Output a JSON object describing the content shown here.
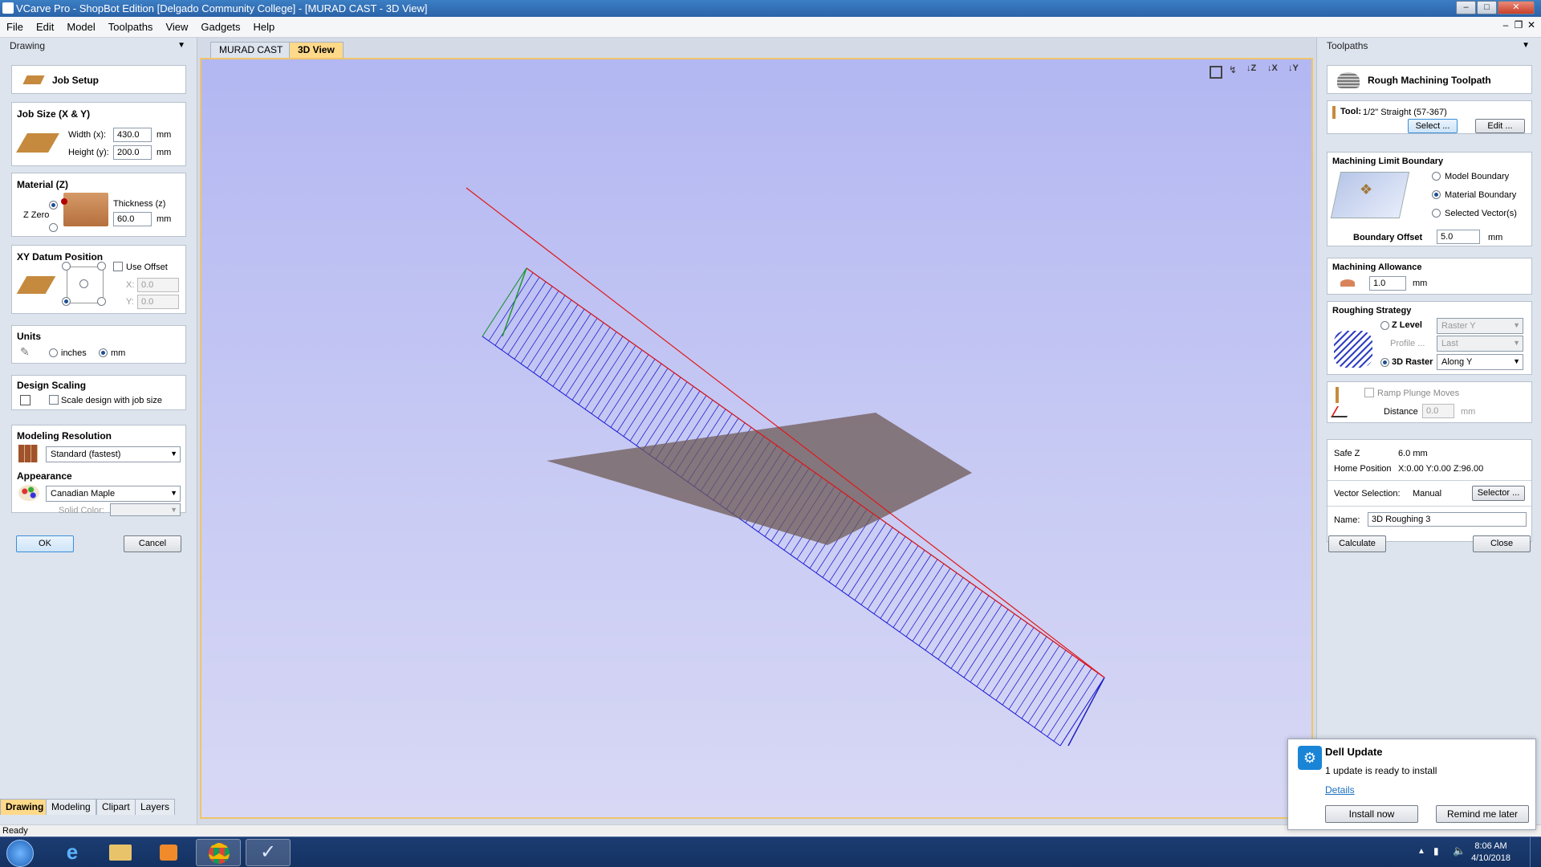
{
  "window": {
    "title": "VCarve Pro - ShopBot Edition [Delgado Community College] - [MURAD CAST - 3D View]"
  },
  "menu": [
    "File",
    "Edit",
    "Model",
    "Toolpaths",
    "View",
    "Gadgets",
    "Help"
  ],
  "left_panel": {
    "header": "Drawing",
    "job_setup": "Job Setup",
    "job_size": {
      "title": "Job Size (X & Y)",
      "width_label": "Width (x):",
      "width_value": "430.0",
      "height_label": "Height (y):",
      "height_value": "200.0",
      "unit": "mm"
    },
    "material": {
      "title": "Material (Z)",
      "z_zero": "Z Zero",
      "thickness_label": "Thickness (z)",
      "thickness_value": "60.0",
      "unit": "mm"
    },
    "xy_datum": {
      "title": "XY Datum Position",
      "use_offset": "Use Offset",
      "x_label": "X:",
      "x_value": "0.0",
      "y_label": "Y:",
      "y_value": "0.0"
    },
    "units": {
      "title": "Units",
      "inches": "inches",
      "mm": "mm"
    },
    "design_scaling": {
      "title": "Design Scaling",
      "scale_label": "Scale design with job size"
    },
    "modeling_resolution": {
      "title": "Modeling Resolution",
      "value": "Standard (fastest)"
    },
    "appearance": {
      "title": "Appearance",
      "value": "Canadian Maple",
      "solid_color": "Solid Color:"
    },
    "ok": "OK",
    "cancel": "Cancel",
    "tabs": [
      "Drawing",
      "Modeling",
      "Clipart",
      "Layers"
    ]
  },
  "doc_tabs": [
    "MURAD CAST",
    "3D View"
  ],
  "view_icons": [
    "fit-view-icon",
    "iso-view-icon",
    "z-view-icon",
    "x-view-icon",
    "y-view-icon"
  ],
  "right_panel": {
    "header": "Toolpaths",
    "title": "Rough Machining Toolpath",
    "tool": {
      "label": "Tool:",
      "value": "1/2\" Straight  (57-367)",
      "select": "Select ...",
      "edit": "Edit ..."
    },
    "boundary": {
      "title": "Machining Limit Boundary",
      "model": "Model Boundary",
      "material": "Material Boundary",
      "vectors": "Selected Vector(s)",
      "offset_label": "Boundary Offset",
      "offset_value": "5.0",
      "unit": "mm"
    },
    "allowance": {
      "title": "Machining Allowance",
      "value": "1.0",
      "unit": "mm"
    },
    "strategy": {
      "title": "Roughing Strategy",
      "zlevel": "Z Level",
      "zlevel_opt": "Raster Y",
      "profile": "Profile ...",
      "profile_opt": "Last",
      "raster": "3D Raster",
      "raster_opt": "Along Y"
    },
    "ramp": {
      "label": "Ramp Plunge Moves",
      "distance_label": "Distance",
      "distance_value": "0.0",
      "unit": "mm"
    },
    "safe_z": {
      "label": "Safe Z",
      "value": "6.0 mm"
    },
    "home": {
      "label": "Home Position",
      "value": "X:0.00 Y:0.00 Z:96.00"
    },
    "vector_sel": {
      "label": "Vector Selection:",
      "value": "Manual",
      "button": "Selector ..."
    },
    "name": {
      "label": "Name:",
      "value": "3D Roughing 3"
    },
    "calculate": "Calculate",
    "close": "Close"
  },
  "status": "Ready",
  "taskbar": {
    "time": "8:06 AM",
    "date": "4/10/2018"
  },
  "notification": {
    "title": "Dell Update",
    "message": "1 update is ready to install",
    "details": "Details",
    "install": "Install now",
    "remind": "Remind me later"
  },
  "colors": {
    "viewport_top": "#b3b7f2",
    "toolpath": "#1f1fd6",
    "boundary_line": "#e01818",
    "active_tab": "#ffd98a"
  }
}
